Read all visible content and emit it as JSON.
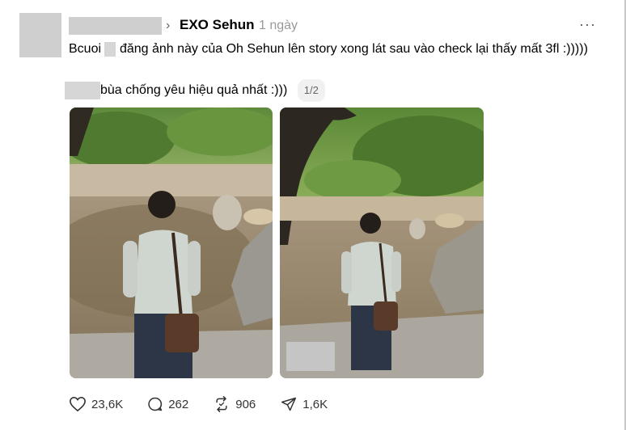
{
  "post": {
    "community": "EXO Sehun",
    "timestamp": "1 ngày",
    "text_line1_a": "Bcuoi",
    "text_line1_b": "đăng ảnh này của Oh Sehun lên story xong lát sau vào check lại thấy mất 3fl :)))))",
    "text_line2": "bùa chống yêu hiệu quả nhất :)))",
    "image_counter": "1/2",
    "more_label": "···",
    "chevron": "›"
  },
  "actions": {
    "likes": "23,6K",
    "comments": "262",
    "reposts": "906",
    "shares": "1,6K"
  },
  "icons": [
    "heart-icon",
    "comment-icon",
    "repost-icon",
    "share-icon",
    "more-icon",
    "chevron-right-icon"
  ]
}
